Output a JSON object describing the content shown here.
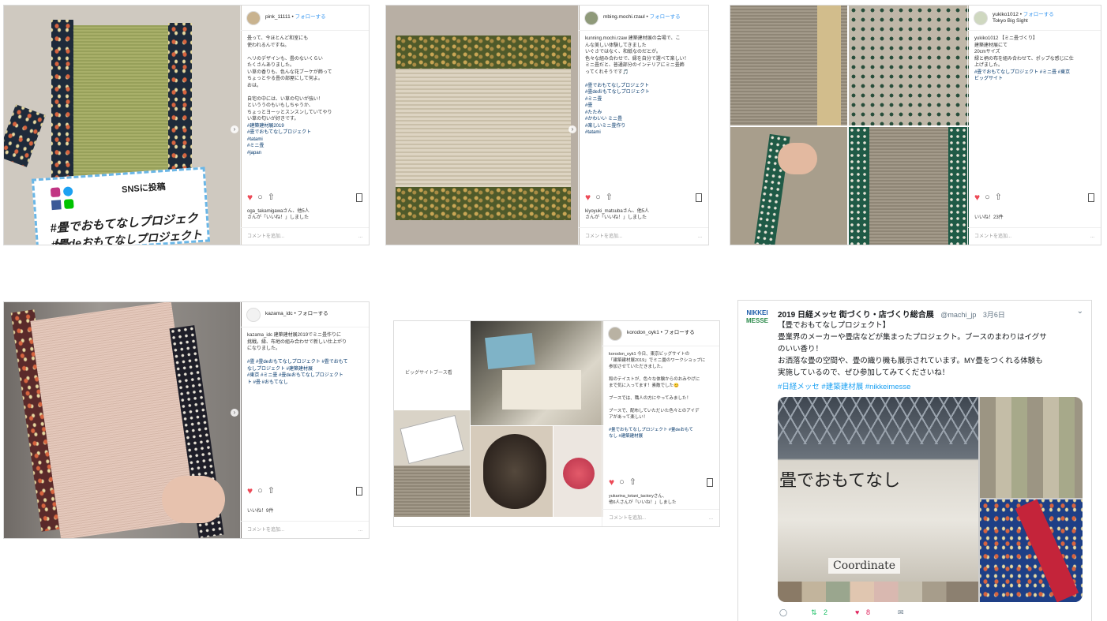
{
  "posts": [
    {
      "user": "pink_11111",
      "follow": "フォローする",
      "caption": "畳って、今ほとんど和室にも\n使われるんですね。\n\nヘリのデザインも、畳のないくらい\nたくさんありました。\nい草の香りも、色んな花ブーケが飾って\nちょっとやる畳の部屋にして何よ。\nおは。\n\n自宅の中には、い草の匂いが強い！\nといううのもいもしちゃうか、\nちょっとヨーッとスンスンしていてやり\nい草の匂いが好きです。",
      "tags": "#建築建材展2019\n#畳でおもてなしプロジェクト\n#tatami\n#ミニ畳\n#japan",
      "likes": "oga_takamigawaさん、他5人\nさんが「いいね！」しました",
      "comment": "コメントを追加...",
      "more": "..."
    },
    {
      "user": "mbing.mochi.rzaul",
      "follow": "フォローする",
      "caption": "kunning.mochi.rzaw 建築建材展の会場で、こ\nんな美しい体験してきました\nいぐさではなく、和紙なのだとが。\n色々な組み合わせで、縁を自分で選べて楽しい！\nミニ畳だと、普通部分のインテリアにミニ畳飾\nってくれそうです🎵",
      "tags": "#畳でおもてなしプロジェクト\n#畳deおもてなしプロジェクト\n#ミニ畳\n#畳\n#たたみ\n#かわいい ミニ畳\n#楽しいミニ畳作り\n#tatami",
      "likes": "kiyoyuki_matsubaさん、他5人\nさんが「いいね！」しました",
      "comment": "コメントを追加...",
      "more": "..."
    },
    {
      "user": "yukiko1012",
      "follow": "フォローする",
      "location": "Tokyo Big Sight",
      "caption": "yukiko1012 【ミニ畳づくり】\n建築建材展にて\n20cmサイズ\n緑と柄の布を組み合わせて、ポップな感じに仕\n上げました。",
      "tags": "#畳でおもてなしプロジェクト #ミニ畳 #東京\nビッグサイト",
      "likes": "いいね！23件",
      "comment": "コメントを追加...",
      "more": "..."
    },
    {
      "user": "kazama_idc",
      "follow": "フォローする",
      "caption": "kazama_idc 建築建材展2019でミニ畳作りに\n挑戦。縁、布地の組み合わせで新しい仕上がり\nになりました。",
      "tags": "#畳 #畳deおもてなしプロジェクト #畳でおもて\nなしプロジェクト #建築建材展\n#東京 #ミニ畳 #畳deおもてなしプロジェクト\nト #畳 #おもてなし",
      "likes": "いいね！9件",
      "comment": "コメントを追加...",
      "more": "..."
    },
    {
      "user": "korodon_oyk1",
      "follow": "フォローする",
      "label": "ビッグサイトブース看",
      "caption": "korodon_oyk1 今日、東京ビッグサイトの\n「建築建材展2019」でミニ畳のワークショップに\n参加させていただきました。\n\n和のテイストが、色々な体験からのおみやげに\nまで気に入ってます！素敵でした😊\n\nブースでは、職人の方にやってみました！\n\nブースで、配布していただいた色々とのアイデ\nアがあって楽しい！",
      "tags": "#畳でおもてなしプロジェクト #畳deおもて\nなし #建築建材展",
      "likes": "yukarina_totani_tactoryさん、\n他6人さんが「いいね！」しました",
      "comment": "コメントを追加...",
      "more": "..."
    }
  ],
  "tweet": {
    "logo": [
      "NIKKEI",
      "MESSE"
    ],
    "name": "2019 日経メッセ 街づくり・店づくり総合展",
    "handle": "@machi_jp",
    "date": "3月6日",
    "text": "【畳でおもてなしプロジェクト】\n畳業界のメーカーや畳店などが集まったプロジェクト。ブースのまわりはイグサ\nのいい香り！\nお洒落な畳の空間や、畳の織り機も展示されています。MY畳をつくれる体験も\n実施しているので、ぜひ参加してみてくださいね！",
    "hashtags": "#日経メッセ #建築建材展 #nikkeimesse",
    "sign": "畳でおもてなし",
    "booth": "Coordinate",
    "retweets": "2",
    "likes": "8"
  },
  "colors": {
    "accent": "#3897f0",
    "heart": "#ed4956",
    "twitter": "#1da1f2"
  },
  "icons": [
    "heart-icon",
    "comment-icon",
    "share-icon",
    "bookmark-icon",
    "reply-icon",
    "retweet-icon",
    "dm-icon",
    "chevron-right-icon",
    "chevron-down-icon"
  ]
}
